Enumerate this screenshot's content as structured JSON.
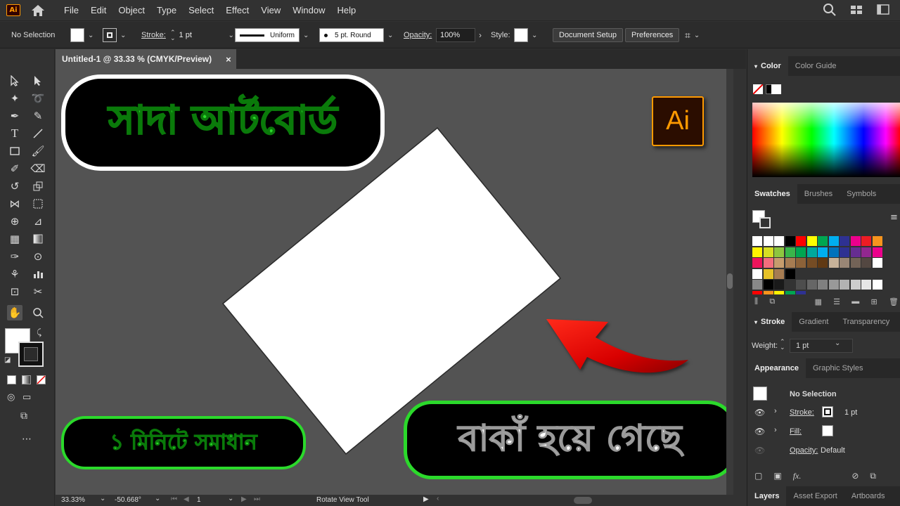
{
  "app": {
    "logo_text": "Ai"
  },
  "menu": [
    "File",
    "Edit",
    "Object",
    "Type",
    "Select",
    "Effect",
    "View",
    "Window",
    "Help"
  ],
  "control_bar": {
    "selection_label": "No Selection",
    "stroke_label": "Stroke:",
    "stroke_value": "1 pt",
    "uniform_label": "Uniform",
    "brush_label": "5 pt. Round",
    "opacity_label": "Opacity:",
    "opacity_value": "100%",
    "style_label": "Style:",
    "document_setup": "Document Setup",
    "preferences": "Preferences"
  },
  "document_tab": {
    "title": "Untitled-1 @ 33.33 % (CMYK/Preview)",
    "close": "×"
  },
  "canvas": {
    "title_callout": "সাদা আর্টবোর্ড",
    "subtitle_callout": "১ মিনিটে সমাধান",
    "bottom_callout": "বাকাঁ হয়ে গেছে",
    "ai_badge": "Ai",
    "artboard_rotation_deg": -36.7,
    "arrow_color": "#e00000",
    "callout_text_color": "#2bd92b"
  },
  "status_bar": {
    "zoom": "33.33%",
    "rotation": "-50.668°",
    "artboard_number": "1",
    "tool_name": "Rotate View Tool"
  },
  "panels": {
    "color_tabs": [
      "Color",
      "Color Guide"
    ],
    "swatches_tabs": [
      "Swatches",
      "Brushes",
      "Symbols"
    ],
    "stroke_tabs": [
      "Stroke",
      "Gradient",
      "Transparency"
    ],
    "stroke_weight_label": "Weight:",
    "stroke_weight_value": "1 pt",
    "appearance_tabs": [
      "Appearance",
      "Graphic Styles"
    ],
    "appearance_selection": "No Selection",
    "appearance_stroke_label": "Stroke:",
    "appearance_stroke_value": "1 pt",
    "appearance_fill_label": "Fill:",
    "appearance_opacity_label": "Opacity:",
    "appearance_opacity_value": "Default",
    "bottom_tabs": [
      "Layers",
      "Asset Export",
      "Artboards"
    ]
  }
}
